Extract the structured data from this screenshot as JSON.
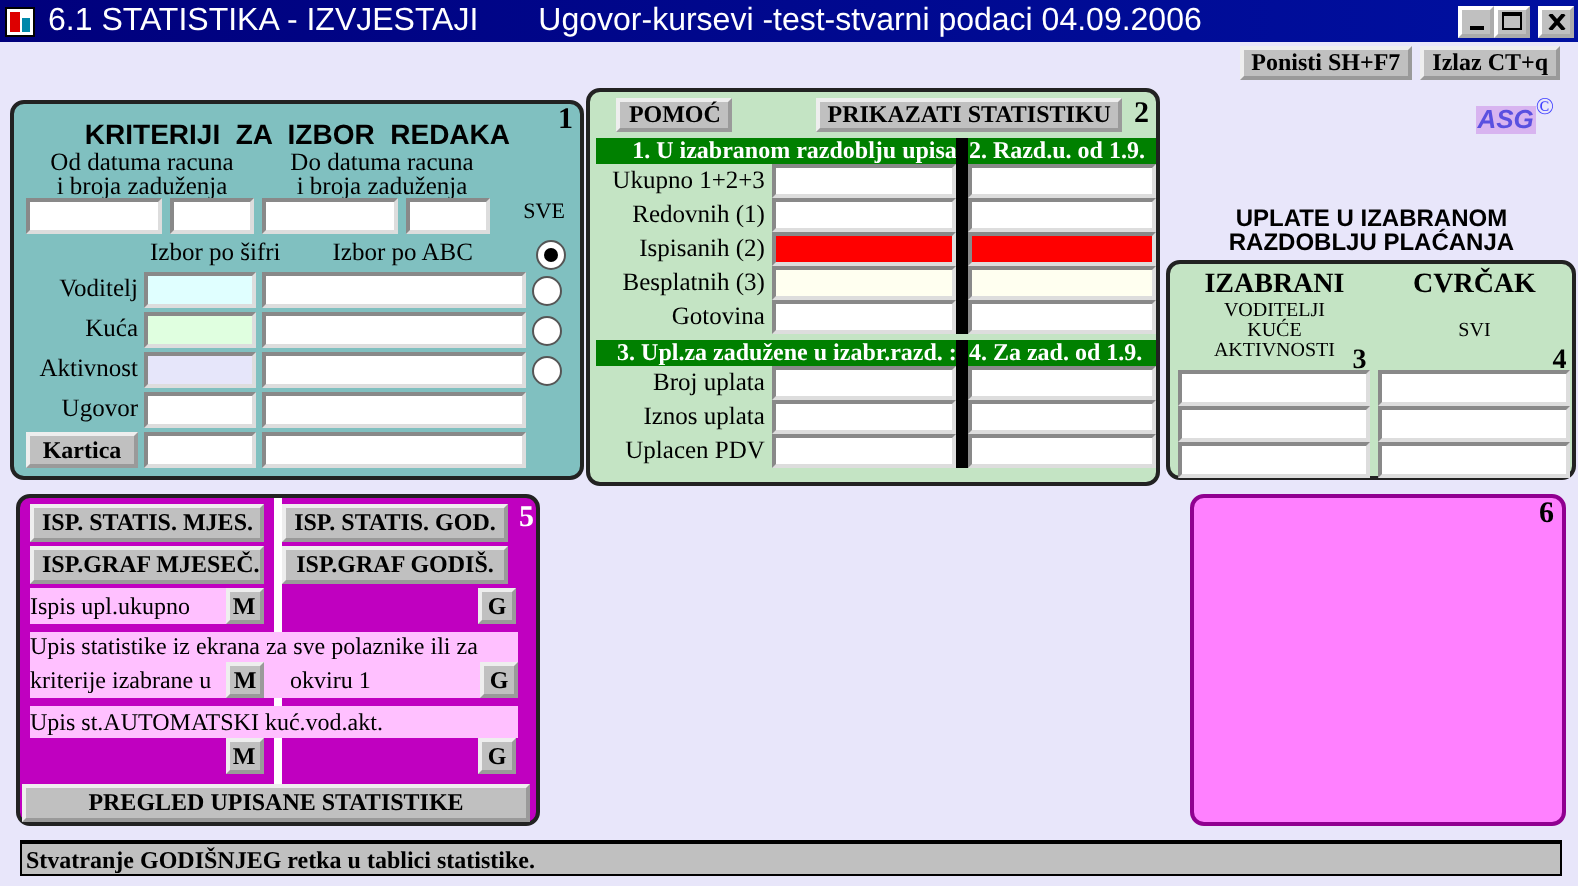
{
  "window": {
    "title": "6.1 STATISTIKA - IZVJESTAJI",
    "subtitle": "Ugovor-kursevi -test-stvarni podaci 04.09.2006"
  },
  "toolbar": [
    "Ponisti SH+F7",
    "Izlaz CT+q"
  ],
  "criteria": {
    "number": "1",
    "title": "KRITERIJI  ZA  IZBOR  REDAKA",
    "from_label": [
      "Od datuma racuna",
      "i broja zaduženja"
    ],
    "to_label": [
      "Do datuma racuna",
      "i broja zaduženja"
    ],
    "all_label": "SVE",
    "all_selected": true,
    "code_header": "Izbor po šifri",
    "abc_header": "Izbor po ABC",
    "rows": [
      {
        "kind": "radio",
        "label": "Voditelj",
        "selected": false,
        "color": "#e0ffff"
      },
      {
        "kind": "radio",
        "label": "Kuća",
        "selected": false,
        "color": "#e0ffe0"
      },
      {
        "kind": "radio",
        "label": "Aktivnost",
        "selected": false,
        "color": "#e6e6fa"
      },
      {
        "kind": "plain",
        "label": "Ugovor",
        "color": "#ffffff"
      },
      {
        "kind": "button",
        "label": "Kartica",
        "color": "#ffffff"
      }
    ]
  },
  "statistics": {
    "number": "2",
    "help_button": "POMOĆ",
    "show_button": "PRIKAZATI STATISTIKU",
    "sections": [
      {
        "heading_left": "1. U izabranom razdoblju upisa",
        "heading_right": "2. Razd.u. od 1.9.",
        "rows": [
          {
            "label": "Ukupno 1+2+3",
            "kind": "normal"
          },
          {
            "label": "Redovnih (1)",
            "kind": "normal"
          },
          {
            "label": "Ispisanih (2)",
            "kind": "alert"
          },
          {
            "label": "Besplatnih (3)",
            "kind": "muted"
          },
          {
            "label": "Gotovina",
            "kind": "normal"
          }
        ]
      },
      {
        "heading_left": "3. Upl.za zadužene u izabr.razd. :",
        "heading_right": "4. Za zad. od 1.9.",
        "rows": [
          {
            "label": "Broj uplata",
            "kind": "normal"
          },
          {
            "label": "Iznos uplata",
            "kind": "normal"
          },
          {
            "label": "Uplacen PDV",
            "kind": "normal"
          }
        ]
      }
    ]
  },
  "logo": {
    "text": "ASG",
    "mark": "©"
  },
  "payments": {
    "heading": [
      "UPLATE U IZABRANOM",
      "RAZDOBLJU PLAĆANJA"
    ],
    "columns": [
      {
        "title": "IZABRANI",
        "lines": [
          "VODITELJI",
          "KUĆE",
          "AKTIVNOSTI"
        ],
        "number": "3"
      },
      {
        "title": "CVRČAK",
        "lines": [
          "SVI"
        ],
        "number": "4"
      }
    ]
  },
  "print_panel": {
    "number": "5",
    "buttons": [
      "ISP. STATIS. MJES.",
      "ISP. STATIS. GOD.",
      "ISP.GRAF MJESEČ.",
      "ISP.GRAF GODIŠ."
    ],
    "actions": [
      {
        "kind": "single",
        "text": "Ispis upl.ukupno",
        "month": "M",
        "year": "G"
      },
      {
        "kind": "split",
        "text": "Upis statistike iz ekrana za sve polaznike ili za",
        "text_left": "kriterije izabrane u",
        "text_right": "okviru 1",
        "month": "M",
        "year": "G"
      },
      {
        "kind": "below",
        "text": "Upis st.AUTOMATSKI kuć.vod.akt.",
        "month": "M",
        "year": "G"
      }
    ],
    "footer_button": "PREGLED UPISANE STATISTIKE"
  },
  "graph_panel": {
    "number": "6"
  },
  "status_bar": "Stvatranje GODIŠNJEG retka u tablici statistike."
}
